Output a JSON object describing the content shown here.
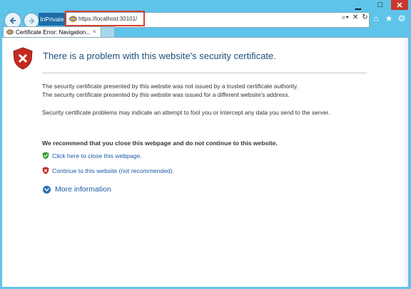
{
  "window": {
    "minimize_icon": "minimize-icon",
    "maximize_icon": "maximize-icon",
    "close_icon": "close-icon"
  },
  "toolbar": {
    "inprivate_label": "InPrivate",
    "address": "https://localhost:30101/",
    "search_icon": "search-icon",
    "refresh_icon": "refresh-icon",
    "icons": [
      "home-icon",
      "favorites-star-icon",
      "settings-gear-icon"
    ]
  },
  "tabs": [
    {
      "label": "Certificate Error: Navigation...",
      "close": "×"
    }
  ],
  "page": {
    "headline": "There is a problem with this website's security certificate.",
    "para1_line1": "The security certificate presented by this website was not issued by a trusted certificate authority.",
    "para1_line2": "The security certificate presented by this website was issued for a different website's address.",
    "para2": "Security certificate problems may indicate an attempt to fool you or intercept any data you send to the server.",
    "recommend": "We recommend that you close this webpage and do not continue to this website.",
    "close_link": "Click here to close this webpage.",
    "continue_link": "Continue to this website (not recommended).",
    "more_info": "More information"
  },
  "colors": {
    "frame": "#5ec4ea",
    "link": "#1a5aa6",
    "headline": "#1f4e79",
    "highlight_box": "#d9402d"
  }
}
